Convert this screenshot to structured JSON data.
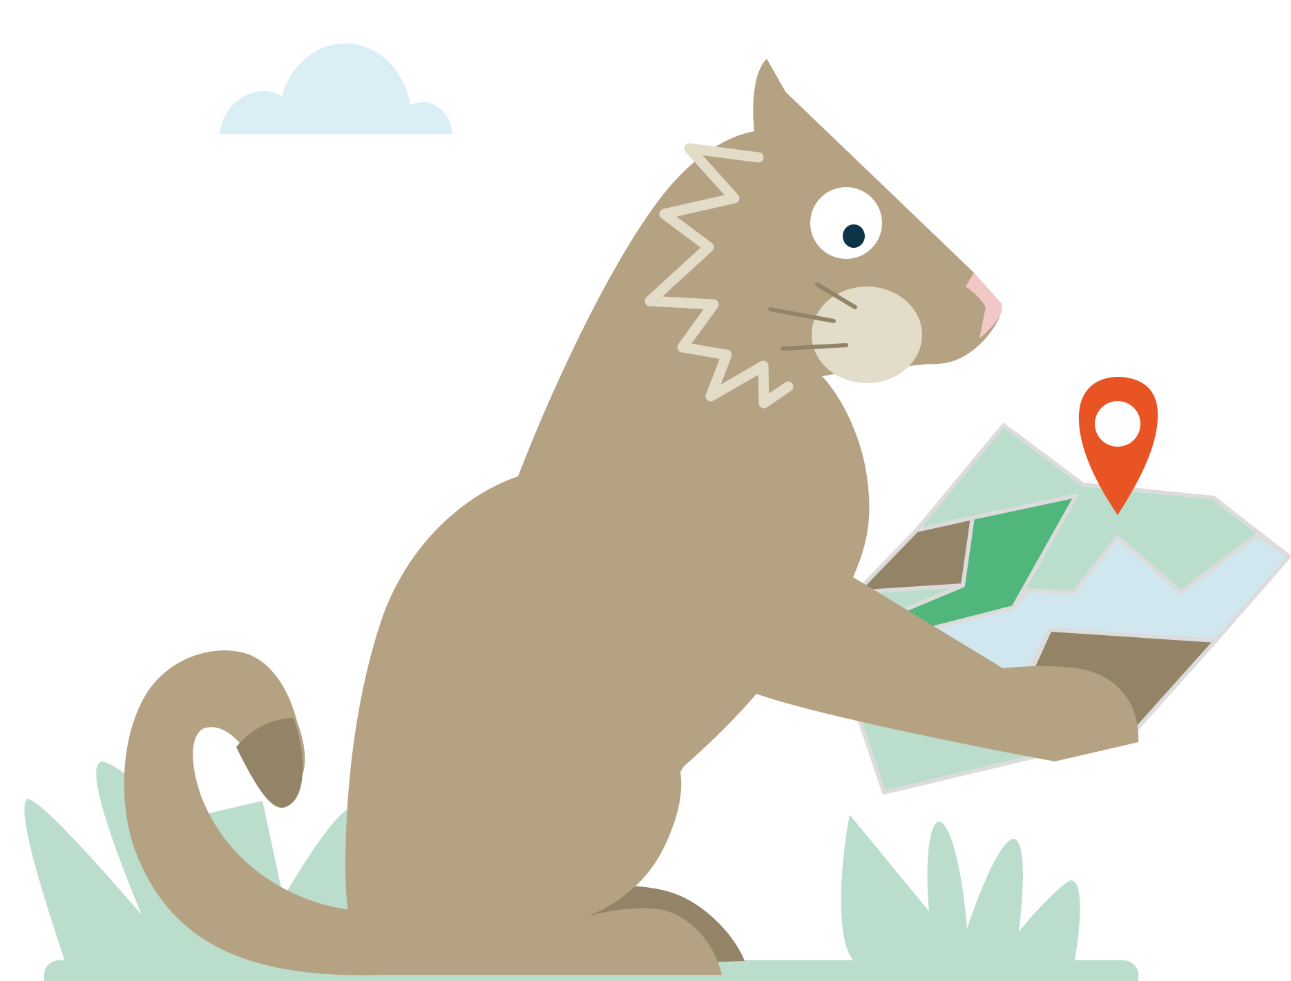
{
  "illustration": {
    "subject": "cougar",
    "colors": {
      "background": "#ffffff",
      "sky_cloud": "#daeef6",
      "fur": "#b5a283",
      "fur_dark": "#938468",
      "muzzle": "#e2dcc8",
      "nose_pink": "#f2c8c6",
      "eye_white": "#ffffff",
      "eye_pupil": "#0d3346",
      "grass": "#badecb",
      "map_light_green": "#badecb",
      "map_green": "#51b67b",
      "map_water": "#d0e7ef",
      "map_land": "#938468",
      "map_border": "#dcdcdc",
      "pin": "#e85423"
    },
    "icons": [
      "location-pin-icon",
      "cloud-icon"
    ]
  }
}
